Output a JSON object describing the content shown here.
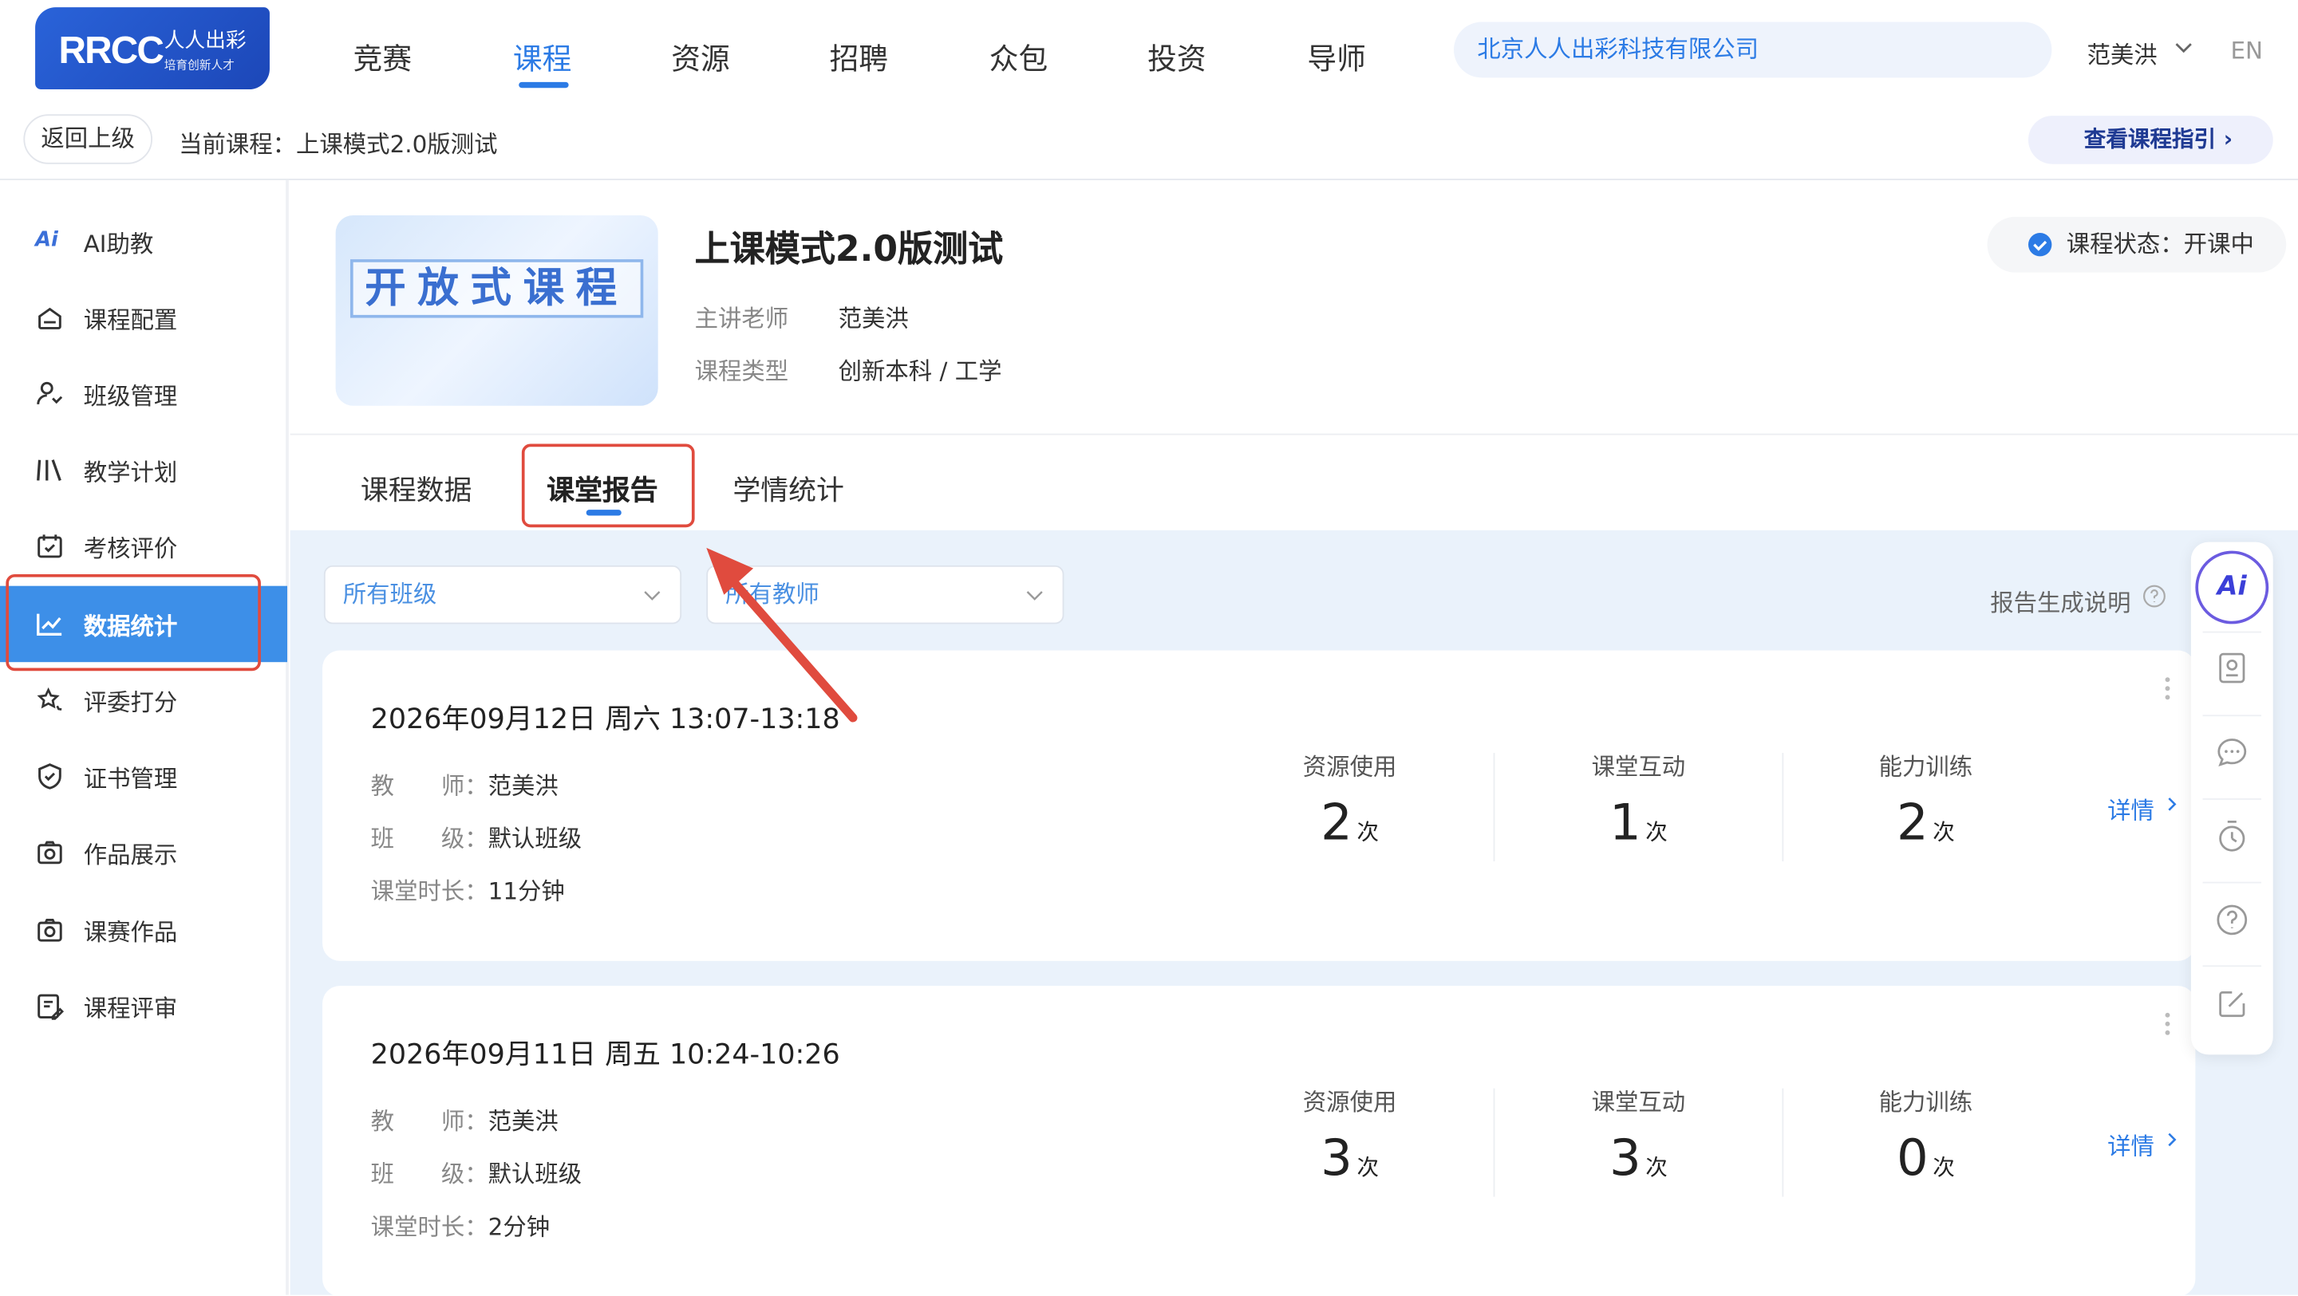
{
  "logo": {
    "brand": "RRCC",
    "cn": "人人出彩",
    "sub": "培育创新人才"
  },
  "nav": {
    "items": [
      "竞赛",
      "课程",
      "资源",
      "招聘",
      "众包",
      "投资",
      "导师"
    ],
    "active": "课程"
  },
  "search": {
    "value": "北京人人出彩科技有限公司"
  },
  "user": {
    "name": "范美洪",
    "lang": "EN"
  },
  "breadcrumb": {
    "back": "返回上级",
    "current": "当前课程：上课模式2.0版测试",
    "guide": "查看课程指引"
  },
  "sidebar": {
    "items": [
      {
        "label": "AI助教",
        "icon": "ai-icon"
      },
      {
        "label": "课程配置",
        "icon": "home-icon"
      },
      {
        "label": "班级管理",
        "icon": "users-icon"
      },
      {
        "label": "教学计划",
        "icon": "books-icon"
      },
      {
        "label": "考核评价",
        "icon": "calendar-check-icon"
      },
      {
        "label": "数据统计",
        "icon": "chart-line-icon"
      },
      {
        "label": "评委打分",
        "icon": "stars-icon"
      },
      {
        "label": "证书管理",
        "icon": "shield-check-icon"
      },
      {
        "label": "作品展示",
        "icon": "camera-icon"
      },
      {
        "label": "课赛作品",
        "icon": "camera-icon"
      },
      {
        "label": "课程评审",
        "icon": "review-icon"
      }
    ],
    "active": "数据统计"
  },
  "course": {
    "cover_text": "开放式课程",
    "title": "上课模式2.0版测试",
    "teacher_label": "主讲老师",
    "teacher": "范美洪",
    "type_label": "课程类型",
    "type": "创新本科 / 工学",
    "status": "课程状态：开课中"
  },
  "tabs": {
    "items": [
      "课程数据",
      "课堂报告",
      "学情统计"
    ],
    "active": "课堂报告"
  },
  "filters": {
    "class": "所有班级",
    "teacher": "所有教师",
    "help": "报告生成说明"
  },
  "reports": [
    {
      "datetime": "2026年09月12日 周六 13:07-13:18",
      "teacher_label": "教　　师：",
      "teacher": "范美洪",
      "class_label": "班　　级：",
      "class": "默认班级",
      "duration_label": "课堂时长：",
      "duration": "11分钟",
      "kpis": [
        {
          "label": "资源使用",
          "value": "2",
          "unit": "次"
        },
        {
          "label": "课堂互动",
          "value": "1",
          "unit": "次"
        },
        {
          "label": "能力训练",
          "value": "2",
          "unit": "次"
        }
      ],
      "detail": "详情"
    },
    {
      "datetime": "2026年09月11日 周五 10:24-10:26",
      "teacher_label": "教　　师：",
      "teacher": "范美洪",
      "class_label": "班　　级：",
      "class": "默认班级",
      "duration_label": "课堂时长：",
      "duration": "2分钟",
      "kpis": [
        {
          "label": "资源使用",
          "value": "3",
          "unit": "次"
        },
        {
          "label": "课堂互动",
          "value": "3",
          "unit": "次"
        },
        {
          "label": "能力训练",
          "value": "0",
          "unit": "次"
        }
      ],
      "detail": "详情"
    }
  ],
  "toolbar": {
    "ai": "Ai",
    "items": [
      "contact-card-icon",
      "chat-icon",
      "timer-icon",
      "help-icon",
      "edit-icon"
    ]
  },
  "colors": {
    "primary": "#2c7be5",
    "highlight": "#e04b3e",
    "sidebar_active": "#3d8fe8"
  }
}
